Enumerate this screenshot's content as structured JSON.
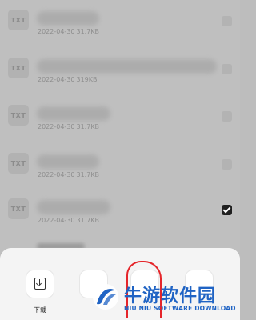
{
  "files": [
    {
      "type": "TXT",
      "date": "2022-04-30",
      "size": "31.7KB",
      "checked": false
    },
    {
      "type": "TXT",
      "date": "2022-04-30",
      "size": "319KB",
      "checked": false
    },
    {
      "type": "TXT",
      "date": "2022-04-30",
      "size": "31.7KB",
      "checked": false
    },
    {
      "type": "TXT",
      "date": "2022-04-30",
      "size": "31.7KB",
      "checked": false
    },
    {
      "type": "TXT",
      "date": "2022-04-30",
      "size": "31.7KB",
      "checked": true
    }
  ],
  "actions": {
    "download_label": "下载"
  },
  "watermark": {
    "title": "牛游软件园",
    "subtitle": "NIU NIU SOFTWARE DOWNLOAD",
    "color": "#1f63c4"
  },
  "colors": {
    "annotation": "#e5252a",
    "checked": "#1f1f1f"
  }
}
